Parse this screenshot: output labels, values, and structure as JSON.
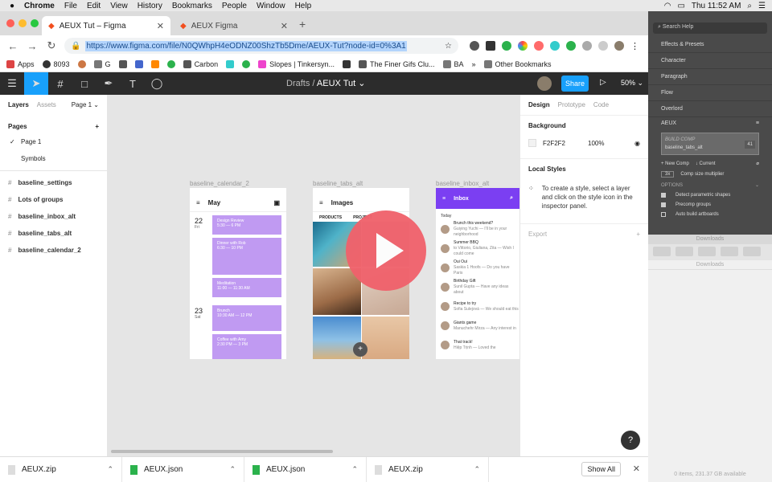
{
  "menubar": {
    "apple": "",
    "app": "Chrome",
    "items": [
      "File",
      "Edit",
      "View",
      "History",
      "Bookmarks",
      "People",
      "Window",
      "Help"
    ],
    "clock": "Thu 11:52 AM"
  },
  "browser": {
    "tabs": [
      {
        "title": "AEUX Tut – Figma",
        "active": true
      },
      {
        "title": "AEUX Figma",
        "active": false
      }
    ],
    "new_tab": "+",
    "url": "https://www.figma.com/file/N0QWhpH4eODNZ00ShzTb5Dme/AEUX-Tut?node-id=0%3A1",
    "bookmarks": [
      "Apps",
      "8093",
      "G",
      "Carbon",
      "Slopes | Tinkersyn...",
      "The Finer Gifs Clu...",
      "BA"
    ],
    "more": "»",
    "other_bookmarks": "Other Bookmarks"
  },
  "figma": {
    "breadcrumb_root": "Drafts",
    "breadcrumb_sep": "/",
    "file_name": "AEUX Tut ⌄",
    "share": "Share",
    "zoom": "50% ⌄",
    "left_tabs": {
      "layers": "Layers",
      "assets": "Assets",
      "page": "Page 1 ⌄"
    },
    "pages_header": "Pages",
    "pages": [
      "Page 1",
      "Symbols"
    ],
    "layers": [
      "baseline_settings",
      "Lots of groups",
      "baseline_inbox_alt",
      "baseline_tabs_alt",
      "baseline_calendar_2"
    ],
    "frames": {
      "cal_label": "baseline_calendar_2",
      "tabs_label": "baseline_tabs_alt",
      "inbox_label": "baseline_inbox_alt",
      "cal_month": "May",
      "cal_day1": "22",
      "cal_day1_sub": "Fri",
      "cal_day2": "23",
      "cal_day2_sub": "Sat",
      "events": [
        "Design Review",
        "Dinner with Rob",
        "Meditation",
        "Brunch",
        "Coffee with Amy"
      ],
      "event_times": [
        "5:30 — 6 PM",
        "6:30 — 10 PM",
        "11:00 — 11:30 AM",
        "10:30 AM — 12 PM",
        "2:30 PM — 3 PM"
      ],
      "images_title": "Images",
      "images_tabs": [
        "PRODUCTS",
        "PROJECT"
      ],
      "inbox_title": "Inbox",
      "today": "Today",
      "messages": [
        {
          "subject": "Brunch this weekend?",
          "from": "Guiying Yuchi",
          "snippet": "— I'll be in your neighborhood"
        },
        {
          "subject": "Summer BBQ",
          "from": "to Vittorio, Giuliana, Zita",
          "snippet": "— Wish I could come"
        },
        {
          "subject": "Oui Oui",
          "from": "Saskia 1 Hoofs",
          "snippet": "— Do you have Paris"
        },
        {
          "subject": "Birthday Gift",
          "from": "Sunil Gupta",
          "snippet": "— Have any ideas about"
        },
        {
          "subject": "Recipe to try",
          "from": "Sofia Sulejová",
          "snippet": "— We should eat this"
        },
        {
          "subject": "Giants game",
          "from": "Manuchehr Mirza",
          "snippet": "— Any interest in"
        },
        {
          "subject": "That track!",
          "from": "Hiệp Trịnh",
          "snippet": "— Loved the"
        }
      ]
    },
    "right_tabs": {
      "design": "Design",
      "prototype": "Prototype",
      "code": "Code"
    },
    "background_label": "Background",
    "bg_hex": "F2F2F2",
    "bg_opacity": "100%",
    "local_styles_label": "Local Styles",
    "local_styles_hint": "To create a style, select a layer and click on the style icon in the inspector panel.",
    "export_label": "Export",
    "help": "?"
  },
  "downloads": [
    {
      "name": "AEUX.zip",
      "type": "zip"
    },
    {
      "name": "AEUX.json",
      "type": "json"
    },
    {
      "name": "AEUX.json",
      "type": "json"
    },
    {
      "name": "AEUX.zip",
      "type": "zip"
    }
  ],
  "show_all": "Show All",
  "ae_panel": {
    "search": "Search Help",
    "sections": [
      "Effects & Presets",
      "Character",
      "Paragraph",
      "Flow",
      "Overlord"
    ],
    "aeux_title": "AEUX",
    "build_comp": "BUILD COMP",
    "build_sub": "baseline_tabs_alt",
    "build_num": "41",
    "new_comp": "New Comp",
    "current": "Current",
    "comp_size_value": "3x",
    "comp_size_label": "Comp size multiplier",
    "options": "OPTIONS",
    "option_items": [
      "Detect parametric shapes",
      "Precomp groups",
      "Auto build artboards"
    ]
  },
  "finder": {
    "title": "Downloads",
    "subtitle": "Downloads",
    "footer": "0 items, 231.37 GB available"
  }
}
